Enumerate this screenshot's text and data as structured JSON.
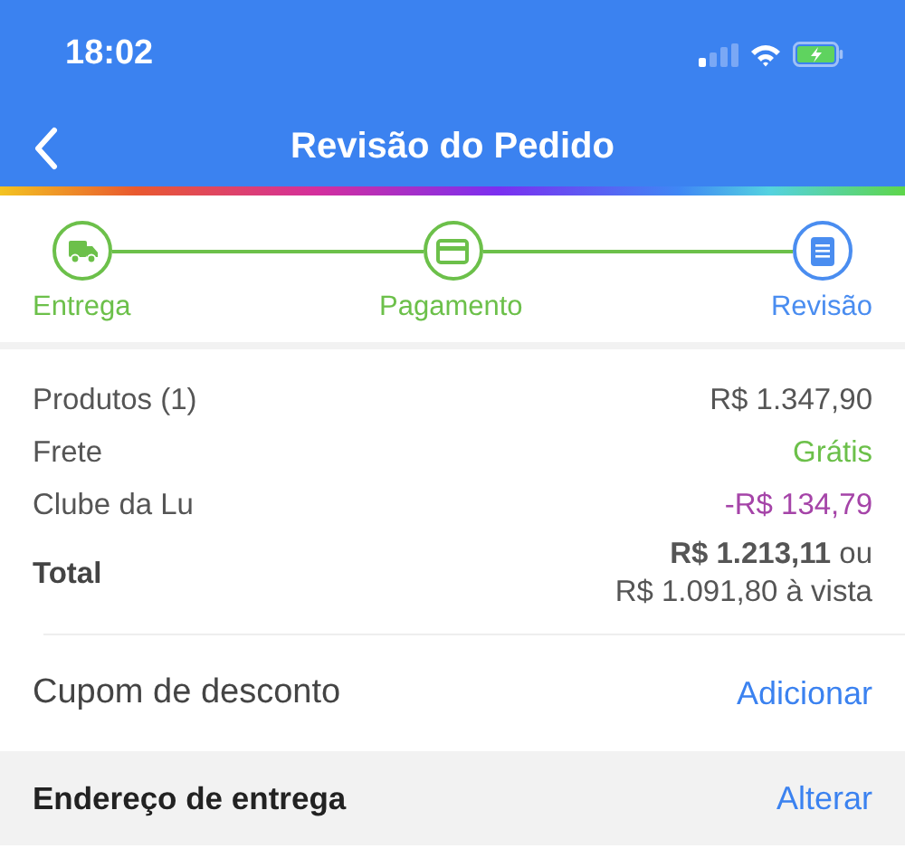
{
  "status_bar": {
    "time": "18:02"
  },
  "nav": {
    "title": "Revisão do Pedido"
  },
  "steps": [
    {
      "label": "Entrega",
      "kind": "truck",
      "selected": false
    },
    {
      "label": "Pagamento",
      "kind": "card",
      "selected": false
    },
    {
      "label": "Revisão",
      "kind": "document",
      "selected": true
    }
  ],
  "summary": [
    {
      "label": "Produtos (1)",
      "value": "R$ 1.347,90",
      "color": "#555555"
    },
    {
      "label": "Frete",
      "value": "Grátis",
      "color": "#6cc04a"
    },
    {
      "label": "Clube da Lu",
      "value": "-R$ 134,79",
      "color": "#a544a8"
    }
  ],
  "total": {
    "label": "Total",
    "lines": [
      "**R$ 1.213,11** ou",
      "R$ 1.091,80 à vista"
    ]
  },
  "coupon": {
    "label": "Cupom de desconto",
    "action": "Adicionar"
  },
  "address": {
    "label": "Endereço de entrega",
    "action": "Alterar"
  }
}
